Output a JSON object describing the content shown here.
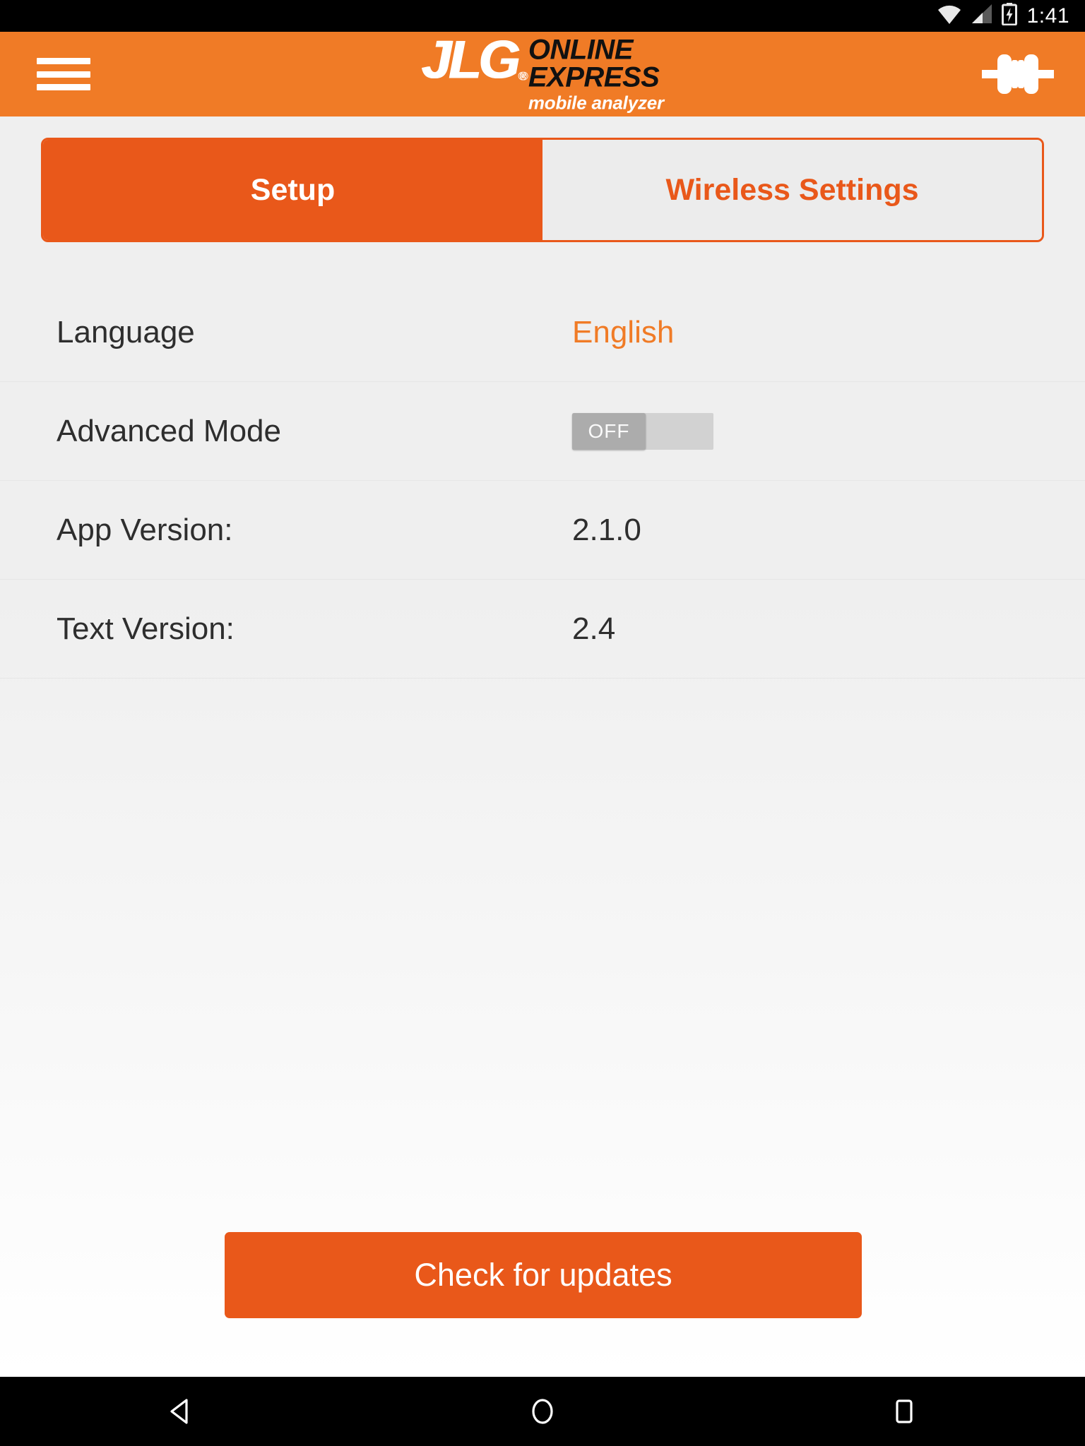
{
  "status_bar": {
    "time": "1:41",
    "icons": [
      "wifi-icon",
      "cellular-signal-icon",
      "battery-charging-icon"
    ]
  },
  "app_bar": {
    "menu_icon": "hamburger-menu-icon",
    "logo": {
      "brand": "JLG",
      "registered_mark": "®",
      "line1": "ONLINE",
      "line2": "EXPRESS",
      "tagline": "mobile analyzer"
    },
    "connection_icon": "connector-disconnected-icon"
  },
  "tabs": [
    {
      "label": "Setup",
      "active": true
    },
    {
      "label": "Wireless Settings",
      "active": false
    }
  ],
  "settings_rows": [
    {
      "label": "Language",
      "value": "English",
      "type": "value-accent"
    },
    {
      "label": "Advanced Mode",
      "value": "OFF",
      "type": "toggle"
    },
    {
      "label": "App Version:",
      "value": "2.1.0",
      "type": "value"
    },
    {
      "label": "Text Version:",
      "value": "2.4",
      "type": "value"
    }
  ],
  "actions": {
    "check_updates_label": "Check for updates"
  },
  "nav_bar": {
    "back": "back-triangle-icon",
    "home": "home-circle-icon",
    "recents": "recents-square-icon"
  },
  "colors": {
    "header_orange": "#F07B26",
    "accent_orange": "#E9581A",
    "background": "#EFEFEF",
    "text_dark": "#2E2E2E"
  }
}
